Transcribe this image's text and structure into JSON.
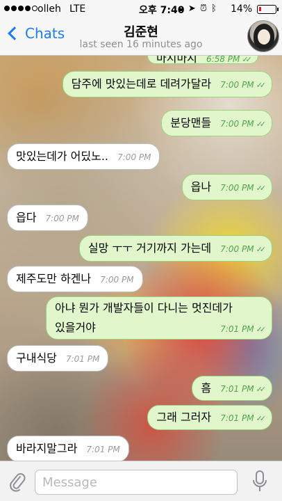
{
  "status_bar": {
    "carrier": "olleh",
    "network": "LTE",
    "time": "오후 7:40",
    "battery": "14%"
  },
  "nav": {
    "back_label": "Chats",
    "contact_name": "김준현",
    "last_seen": "last seen 16 minutes ago"
  },
  "messages": [
    {
      "dir": "out",
      "text": "담주에 맛있는데로 데려가달라",
      "time": "7:00 PM"
    },
    {
      "dir": "out",
      "text": "분당맨들",
      "time": "7:00 PM"
    },
    {
      "dir": "in",
      "text": "맛있는데가 어딨노..",
      "time": "7:00 PM"
    },
    {
      "dir": "out",
      "text": "읍나",
      "time": "7:00 PM"
    },
    {
      "dir": "in",
      "text": "읍다",
      "time": "7:00 PM"
    },
    {
      "dir": "out",
      "text": "실망 ㅜㅜ 거기까지 가는데",
      "time": "7:00 PM"
    },
    {
      "dir": "in",
      "text": "제주도만 하겐나",
      "time": "7:00 PM"
    },
    {
      "dir": "out",
      "text_line1": "아냐 뭔가 개발자들이 다니는 멋진데가",
      "text_line2": "있을거야",
      "time": "7:01 PM"
    },
    {
      "dir": "in",
      "text": "구내식당",
      "time": "7:01 PM"
    },
    {
      "dir": "out",
      "text": "흠",
      "time": "7:01 PM"
    },
    {
      "dir": "out",
      "text": "그래 그러자",
      "time": "7:01 PM"
    },
    {
      "dir": "in",
      "text": "바라지말그라",
      "time": "7:01 PM"
    }
  ],
  "partial_top_message": {
    "text": "마시마지",
    "time": "6:58 PM"
  },
  "input": {
    "placeholder": "Message"
  },
  "colors": {
    "accent": "#1a7cf5",
    "outgoing_bubble": "#e1f7cb",
    "incoming_bubble": "#ffffff",
    "outgoing_meta": "#4fa44c"
  },
  "icons": {
    "attach": "paperclip-icon",
    "mic": "microphone-icon",
    "back": "chevron-left-icon",
    "read": "double-check-icon"
  }
}
